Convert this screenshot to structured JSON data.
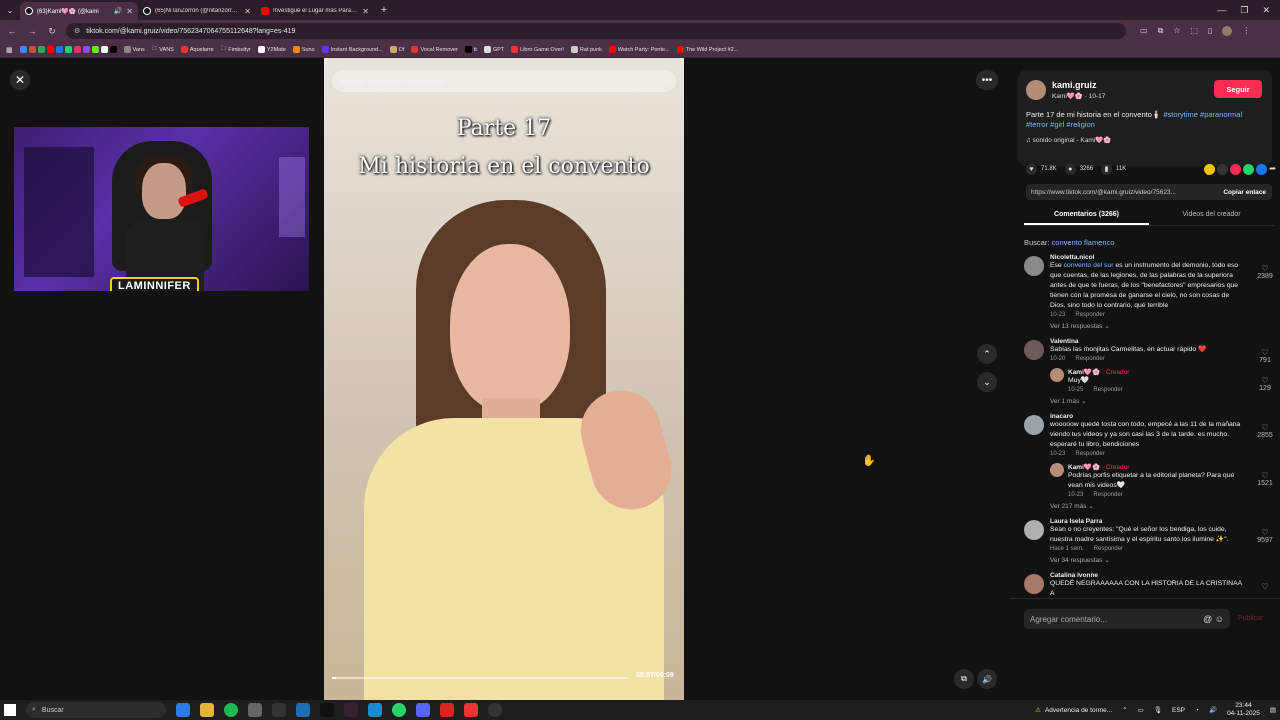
{
  "browser": {
    "tabs": [
      {
        "label": "(63)Kami🩷🌸 (@kami",
        "active": true,
        "icon": "tiktok-icon"
      },
      {
        "label": "(65)NiTanZorron (@nitanzorron)",
        "active": false,
        "icon": "tiktok-icon"
      },
      {
        "label": "Investigué el Lugar más Paranor...",
        "active": false,
        "icon": "youtube-icon"
      }
    ],
    "new_tab": "+",
    "url": "tiktok.com/@kami.gruiz/video/7562347064755112648?lang=es-419",
    "bookmarks": [
      "Vans",
      "VANS",
      "Aquelarre",
      "Fimbultyr",
      "Y2Mate",
      "Suno",
      "Instant Background...",
      "Of",
      "Vocal Remover",
      "tt",
      "GPT",
      "Libro Game Over!",
      "Rat punk",
      "Watch Party: Ponte...",
      "The Wild Project #2..."
    ]
  },
  "webcam": {
    "label": "LAMINNIFER"
  },
  "video": {
    "search_placeholder": "Buscar contenido relacionado",
    "title_line1": "Parte 17",
    "title_line2": "Mi historia en el convento",
    "time": "00:07/09:09",
    "progress": 0.013
  },
  "creator": {
    "name": "kami.gruiz",
    "sub": "Kami🩷🌸 · 10-17",
    "follow": "Seguir",
    "caption_text": "Parte 17 de mi historia en el convento🕯️",
    "caption_tags": "#storytime #paranormal #terror #girl #religion",
    "sound": "♫ sonido original - Kami🩷🌸"
  },
  "stats": {
    "likes": "71.8K",
    "comments": "3266",
    "saves": "11K"
  },
  "link": {
    "url": "https://www.tiktok.com/@kami.gruiz/video/75623...",
    "copy": "Copiar enlace"
  },
  "panel_tabs": {
    "comments": "Comentarios (3266)",
    "creator_videos": "Videos del creador"
  },
  "search_suggest": {
    "prefix": "Buscar:",
    "keyword": "convento flamenco"
  },
  "comments": [
    {
      "name": "Nicoletta.nicol",
      "text_pre": "Ese ",
      "keyword": "convento del sur",
      "text": " es un instrumento del demonio, todo eso que cuentas, de las legiones, de las palabras de la superiora antes de que te fueras, de los \"benefactores\" empresarios que tienen con la promesa de ganarse el cielo, no son cosas de Dios, sino todo lo contrario, qué terrible",
      "date": "10-23",
      "reply": "Responder",
      "likes": "2389",
      "more": "Ver 13 respuestas ⌄"
    },
    {
      "name": "Valentina",
      "text": "Sabías las monjitas Carmelitas, en actuar rápido ❤️",
      "date": "10-20",
      "reply": "Responder",
      "likes": "791",
      "creator_reply": {
        "name": "Kami🩷🌸",
        "tag": "· Creador",
        "text": "Muy🤍",
        "date": "10-25",
        "reply": "Responder",
        "likes": "129"
      },
      "more": "Ver 1 más ⌄"
    },
    {
      "name": "inacaro",
      "text": "wooooow quedé tosta con todo, empecé a las 11 de la mañana viendo tus videos y ya son casi las 3 de la tarde. es mucho. esperaré tu libro, bendiciones",
      "date": "10-23",
      "reply": "Responder",
      "likes": "2855",
      "creator_reply": {
        "name": "Kami🩷🌸",
        "tag": "· Creador",
        "text": "Podrías porfis etiquetar a la editorial planeta? Para que vean mis videos🤍",
        "date": "10-23",
        "reply": "Responder",
        "likes": "1521"
      },
      "more": "Ver 217 más ⌄"
    },
    {
      "name": "Laura Isela Parra",
      "text": "Sean o no creyentes: \"Qué el señor los bendiga, los cuide, nuestra madre santísima y el espíritu santo los ilumine ✨\".",
      "date": "Hace 1 sem.",
      "reply": "Responder",
      "likes": "9597",
      "more": "Ver 34 respuestas ⌄"
    },
    {
      "name": "Catalina Ivonne",
      "text": "QUEDÉ NEGRAAAAAA CON LA HISTORIA DE LA CRISTINAA A",
      "date": "",
      "reply": "",
      "likes": "",
      "more": ""
    }
  ],
  "comment_bar": {
    "placeholder": "Agregar comentario...",
    "publish": "Publicar"
  },
  "taskbar": {
    "search": "Buscar",
    "weather": "Advertencia de torme...",
    "lang": "ESP",
    "time": "23:44",
    "date": "04-11-2025"
  },
  "colors": {
    "accent": "#fe2c55",
    "link": "#7db8ff",
    "browser_frame": "#4a2f45"
  }
}
